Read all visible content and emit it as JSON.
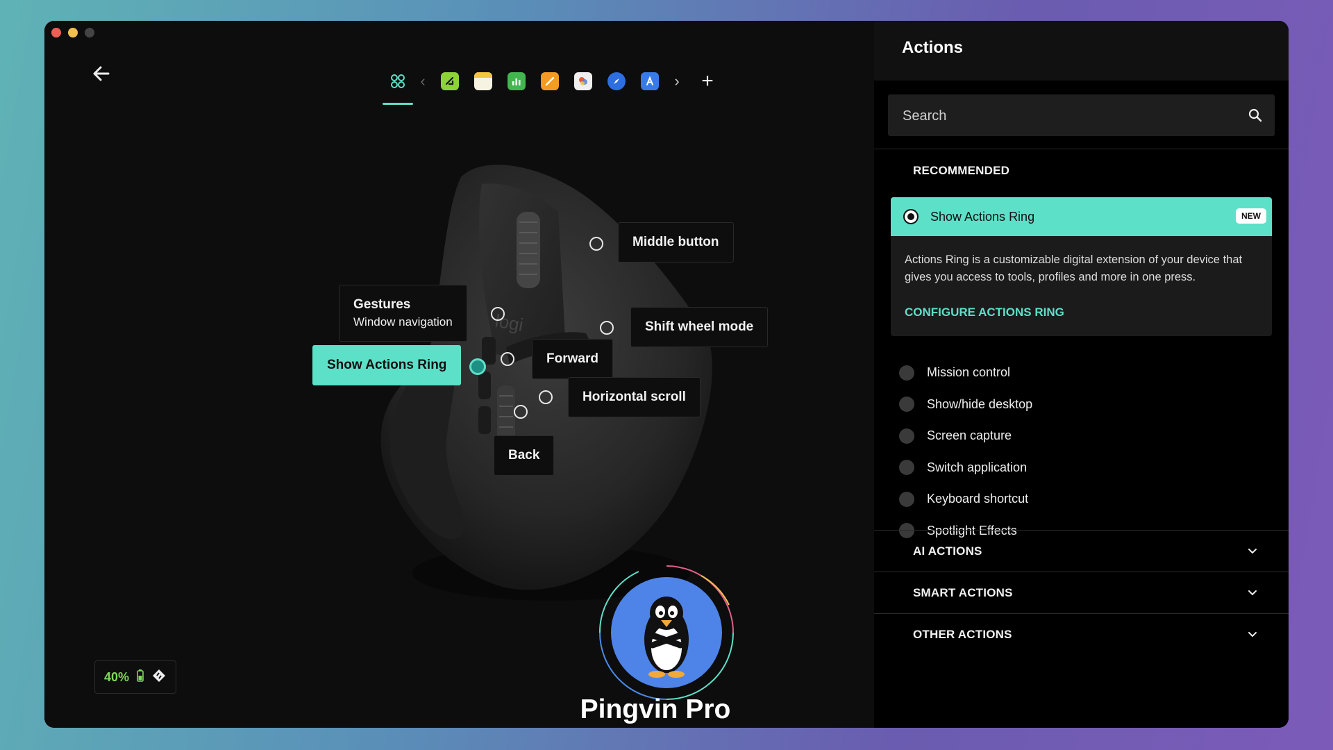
{
  "window": {
    "toolbar": {
      "apps": [
        {
          "name": "all-applications",
          "glyph": ""
        },
        {
          "name": "app-1",
          "glyph": "",
          "color": "#8ed23a"
        },
        {
          "name": "app-2",
          "glyph": "",
          "color": "#f3c640"
        },
        {
          "name": "app-3",
          "glyph": "",
          "color": "#43b650"
        },
        {
          "name": "app-4",
          "glyph": "",
          "color": "#f59a24"
        },
        {
          "name": "app-5",
          "glyph": "",
          "color": "#e8e8e8"
        },
        {
          "name": "app-6",
          "glyph": "",
          "color": "#2d6ee0"
        },
        {
          "name": "app-7",
          "glyph": "",
          "color": "#3a7ae8"
        }
      ]
    }
  },
  "mouse": {
    "buttons": {
      "middle": "Middle button",
      "gestures_title": "Gestures",
      "gestures_sub": "Window navigation",
      "shift_wheel": "Shift wheel mode",
      "actions_ring": "Show Actions Ring",
      "forward": "Forward",
      "horizontal_scroll": "Horizontal scroll",
      "back": "Back"
    }
  },
  "battery": {
    "percent": "40%"
  },
  "profile": {
    "name": "Pingvin Pro"
  },
  "actions": {
    "title": "Actions",
    "search_placeholder": "Search",
    "recommended_header": "RECOMMENDED",
    "recommended": {
      "label": "Show Actions Ring",
      "badge": "NEW",
      "description": "Actions Ring is a customizable digital extension of your device that gives you access to tools, profiles and more in one press.",
      "link": "CONFIGURE ACTIONS RING"
    },
    "list": [
      "Mission control",
      "Show/hide desktop",
      "Screen capture",
      "Switch application",
      "Keyboard shortcut",
      "Spotlight Effects"
    ],
    "sections": [
      "AI ACTIONS",
      "SMART ACTIONS",
      "OTHER ACTIONS"
    ]
  },
  "colors": {
    "accent": "#5de0c8",
    "battery": "#7fd858"
  }
}
